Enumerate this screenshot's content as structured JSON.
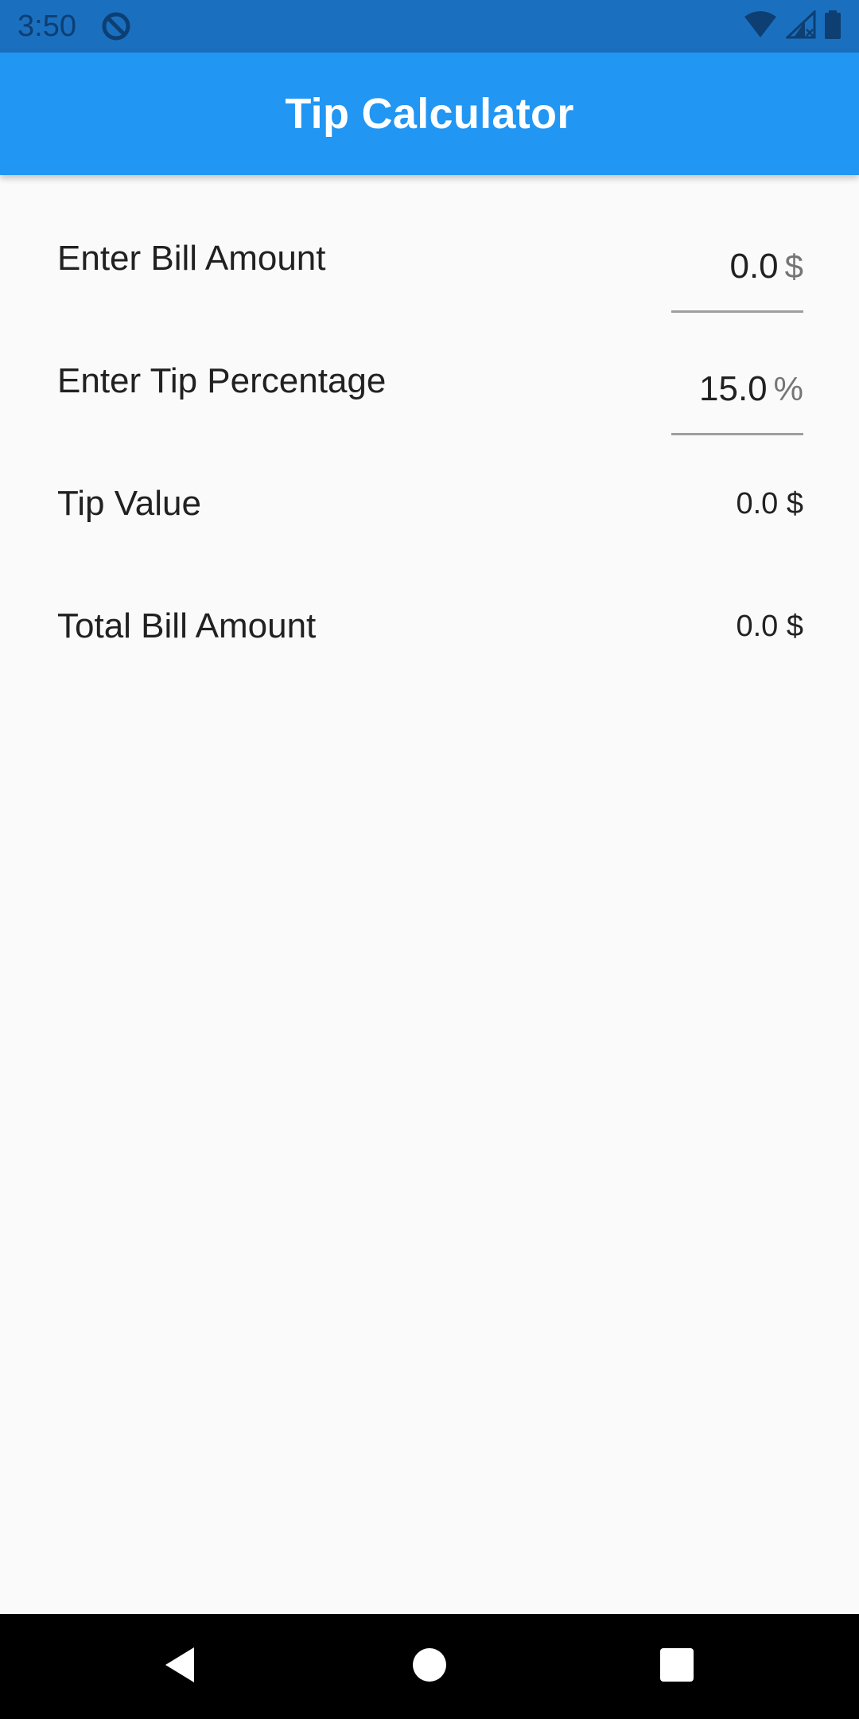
{
  "status_bar": {
    "time": "3:50",
    "icons": [
      "app-notification-icon",
      "wifi-icon",
      "signal-icon",
      "battery-icon"
    ]
  },
  "app_bar": {
    "title": "Tip Calculator"
  },
  "form": {
    "bill": {
      "label": "Enter Bill Amount",
      "value": "0.0",
      "suffix": "$"
    },
    "tip_percentage": {
      "label": "Enter Tip Percentage",
      "value": "15.0",
      "suffix": "%"
    },
    "tip_value": {
      "label": "Tip Value",
      "value": "0.0 $"
    },
    "total": {
      "label": "Total Bill Amount",
      "value": "0.0 $"
    }
  },
  "nav_bar": {
    "icons": [
      "back-icon",
      "home-icon",
      "recents-icon"
    ]
  },
  "colors": {
    "status_bar": "#1b6fbf",
    "app_bar": "#2196f3",
    "background": "#fafafa",
    "nav_bar": "#000000"
  }
}
